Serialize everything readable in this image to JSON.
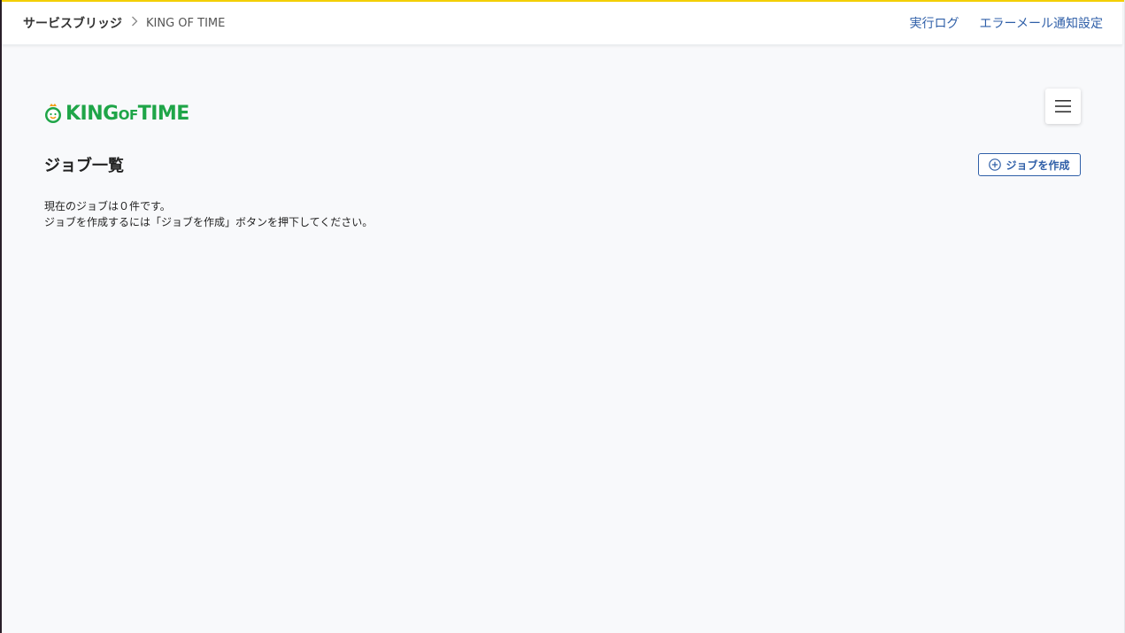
{
  "header": {
    "breadcrumb_root": "サービスブリッジ",
    "breadcrumb_separator": ">",
    "breadcrumb_current": "KING OF TIME",
    "links": [
      "実行ログ",
      "エラーメール通知設定"
    ]
  },
  "logo": {
    "text_part1": "KING",
    "text_part2": "OF",
    "text_part3": "TIME",
    "color": "#1fa548"
  },
  "menu_button": {
    "icon": "hamburger-menu-icon"
  },
  "main": {
    "title": "ジョブ一覧",
    "create_button_label": "ジョブを作成",
    "create_button_icon": "plus-circle-icon",
    "message_line1": "現在のジョブは０件です。",
    "message_line2": "ジョブを作成するには「ジョブを作成」ボタンを押下してください。"
  },
  "colors": {
    "accent_top": "#f5d000",
    "link": "#2f5fa8",
    "background": "#f8f9fb"
  }
}
